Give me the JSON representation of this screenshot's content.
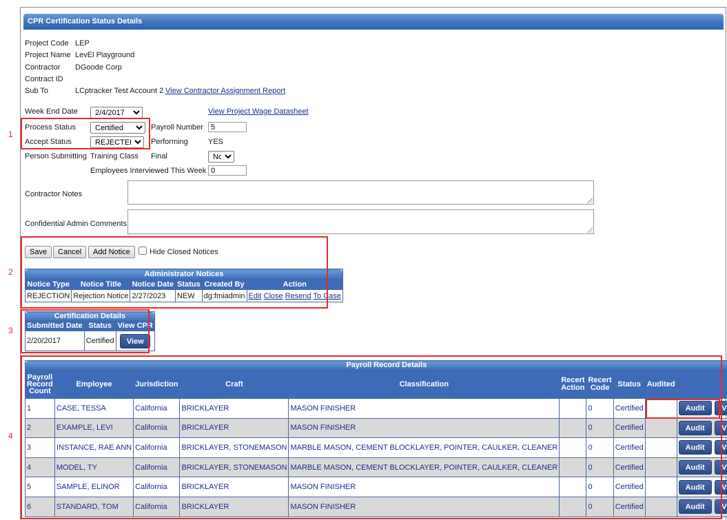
{
  "header": {
    "title": "CPR Certification Status Details"
  },
  "project": {
    "fields": [
      {
        "label": "Project Code",
        "value": "LEP"
      },
      {
        "label": "Project Name",
        "value": "LevEl Playground"
      },
      {
        "label": "Contractor",
        "value": "DGoode Corp"
      },
      {
        "label": "Contract ID",
        "value": ""
      },
      {
        "label": "Sub To",
        "value": "LCptracker Test Account 2"
      }
    ],
    "assignment_link": "View Contractor Assignment Report"
  },
  "form": {
    "week_end_label": "Week End Date",
    "week_end_value": "2/4/2017",
    "wage_link": "View Project Wage Datasheet",
    "process_label": "Process Status",
    "process_value": "Certified",
    "payroll_label": "Payroll Number",
    "payroll_value": "5",
    "accept_label": "Accept Status",
    "accept_value": "REJECTED",
    "performing_label": "Performing",
    "performing_value": "YES",
    "person_label": "Person Submitting",
    "training_label": "Training Class",
    "final_label": "Final",
    "final_value": "No",
    "interviewed_label": "Employees Interviewed This Week",
    "interviewed_value": "0",
    "contractor_notes_label": "Contractor Notes",
    "confidential_label": "Confidential Admin Comments"
  },
  "actions": {
    "save": "Save",
    "cancel": "Cancel",
    "add_notice": "Add Notice",
    "hide_closed": "Hide Closed Notices"
  },
  "notices": {
    "title": "Administrator Notices",
    "columns": [
      "Notice Type",
      "Notice Title",
      "Notice Date",
      "Status",
      "Created By",
      "Action"
    ],
    "rows": [
      {
        "type": "REJECTION",
        "title": "Rejection Notice",
        "date": "2/27/2023",
        "status": "NEW",
        "created_by": "dg:fmiadmin",
        "actions": [
          "Edit",
          "Close",
          "Resend",
          "To Case"
        ]
      }
    ]
  },
  "certification": {
    "title": "Certification Details",
    "columns": [
      "Submitted Date",
      "Status",
      "View CPR"
    ],
    "row": {
      "date": "2/20/2017",
      "status": "Certified",
      "button": "View"
    }
  },
  "payroll": {
    "title": "Payroll Record Details",
    "columns": [
      "Payroll Record Count",
      "Employee",
      "Jurisdiction",
      "Craft",
      "Classification",
      "Recert Action",
      "Recert Code",
      "Status",
      "Audited",
      ""
    ],
    "audit_label": "Audit",
    "view_label": "View",
    "rows": [
      {
        "count": "1",
        "employee": "CASE, TESSA",
        "jurisdiction": "California",
        "craft": "BRICKLAYER",
        "classification": "MASON FINISHER",
        "recert_action": "",
        "recert_code": "0",
        "status": "Certified",
        "audited": ""
      },
      {
        "count": "2",
        "employee": "EXAMPLE, LEVI",
        "jurisdiction": "California",
        "craft": "BRICKLAYER",
        "classification": "MASON FINISHER",
        "recert_action": "",
        "recert_code": "0",
        "status": "Certified",
        "audited": ""
      },
      {
        "count": "3",
        "employee": "INSTANCE, RAE ANN",
        "jurisdiction": "California",
        "craft": "BRICKLAYER, STONEMASON",
        "classification": "MARBLE MASON, CEMENT BLOCKLAYER, POINTER, CAULKER, CLEANER",
        "recert_action": "",
        "recert_code": "0",
        "status": "Certified",
        "audited": ""
      },
      {
        "count": "4",
        "employee": "MODEL, TY",
        "jurisdiction": "California",
        "craft": "BRICKLAYER, STONEMASON",
        "classification": "MARBLE MASON, CEMENT BLOCKLAYER, POINTER, CAULKER, CLEANER",
        "recert_action": "",
        "recert_code": "0",
        "status": "Certified",
        "audited": ""
      },
      {
        "count": "5",
        "employee": "SAMPLE, ELINOR",
        "jurisdiction": "California",
        "craft": "BRICKLAYER",
        "classification": "MASON FINISHER",
        "recert_action": "",
        "recert_code": "0",
        "status": "Certified",
        "audited": ""
      },
      {
        "count": "6",
        "employee": "STANDARD, TOM",
        "jurisdiction": "California",
        "craft": "BRICKLAYER",
        "classification": "MASON FINISHER",
        "recert_action": "",
        "recert_code": "0",
        "status": "Certified",
        "audited": ""
      }
    ]
  },
  "annotations": [
    "1",
    "2",
    "3",
    "4"
  ],
  "colors": {
    "header_blue": "#3f73bd",
    "callout_red": "#e22c2c",
    "link_blue": "#1a2f8a",
    "row_alt": "#d9d9d9"
  }
}
